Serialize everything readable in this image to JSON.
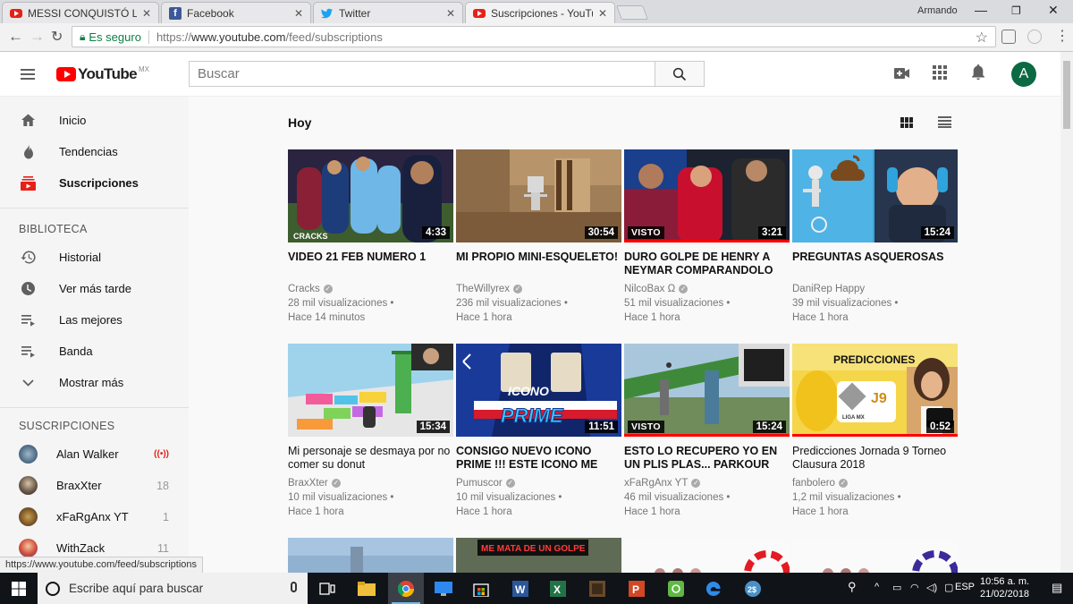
{
  "browser": {
    "tabs": [
      {
        "title": "MESSI CONQUISTÓ LON",
        "favicon": "youtube-favicon",
        "active": false
      },
      {
        "title": "Facebook",
        "favicon": "facebook-favicon",
        "active": false
      },
      {
        "title": "Twitter",
        "favicon": "twitter-favicon",
        "active": false
      },
      {
        "title": "Suscripciones - YouTube",
        "favicon": "youtube-favicon",
        "active": true
      }
    ],
    "profile_name": "Armando",
    "secure_label": "Es seguro",
    "url_scheme": "https://",
    "url_host": "www.youtube.com",
    "url_path": "/feed/subscriptions",
    "status_url": "https://www.youtube.com/feed/subscriptions"
  },
  "masthead": {
    "logo_text": "YouTube",
    "country_code": "MX",
    "search_placeholder": "Buscar",
    "avatar_letter": "A"
  },
  "sidebar": {
    "nav": [
      {
        "label": "Inicio",
        "icon": "home-icon"
      },
      {
        "label": "Tendencias",
        "icon": "flame-icon"
      },
      {
        "label": "Suscripciones",
        "icon": "subscriptions-icon",
        "active": true
      }
    ],
    "library_heading": "BIBLIOTECA",
    "library": [
      {
        "label": "Historial",
        "icon": "history-icon"
      },
      {
        "label": "Ver más tarde",
        "icon": "clock-icon"
      },
      {
        "label": "Las mejores",
        "icon": "playlist-icon"
      },
      {
        "label": "Banda",
        "icon": "playlist-icon"
      },
      {
        "label": "Mostrar más",
        "icon": "chevron-down-icon"
      }
    ],
    "subscriptions_heading": "SUSCRIPCIONES",
    "subscriptions": [
      {
        "name": "Alan Walker",
        "count": "((•))",
        "live": true
      },
      {
        "name": "BraxXter",
        "count": "18"
      },
      {
        "name": "xFaRgAnx YT",
        "count": "1"
      },
      {
        "name": "WithZack",
        "count": "11"
      }
    ]
  },
  "main": {
    "shelf_title": "Hoy",
    "videos": [
      {
        "title": "VIDEO 21 FEB NUMERO 1",
        "channel": "Cracks",
        "views": "28 mil visualizaciones",
        "age": "Hace 14 minutos",
        "duration": "4:33",
        "watched": "",
        "verified": true,
        "bold": true
      },
      {
        "title": "MI PROPIO MINI-ESQUELETO!",
        "channel": "TheWillyrex",
        "views": "236 mil visualizaciones",
        "age": "Hace 1 hora",
        "duration": "30:54",
        "watched": "",
        "verified": true,
        "bold": true
      },
      {
        "title": "DURO GOLPE DE HENRY A NEYMAR COMPARANDOLO",
        "channel": "NilcoBax Ω",
        "views": "51 mil visualizaciones",
        "age": "Hace 1 hora",
        "duration": "3:21",
        "watched": "VISTO",
        "progress": 1.0,
        "verified": true,
        "bold": true
      },
      {
        "title": "PREGUNTAS ASQUEROSAS",
        "channel": "DaniRep Happy",
        "views": "39 mil visualizaciones",
        "age": "Hace 1 hora",
        "duration": "15:24",
        "watched": "",
        "verified": false,
        "bold": true
      },
      {
        "title": "Mi personaje se desmaya por no comer su donut",
        "channel": "BraxXter",
        "views": "10 mil visualizaciones",
        "age": "Hace 1 hora",
        "duration": "15:34",
        "watched": "",
        "verified": true,
        "bold": false
      },
      {
        "title": "CONSIGO NUEVO ICONO PRIME !!! ESTE ICONO ME",
        "channel": "Pumuscor",
        "views": "10 mil visualizaciones",
        "age": "Hace 1 hora",
        "duration": "11:51",
        "watched": "",
        "verified": true,
        "bold": true
      },
      {
        "title": "ESTO LO RECUPERO YO EN UN PLIS PLAS... PARKOUR",
        "channel": "xFaRgAnx YT",
        "views": "46 mil visualizaciones",
        "age": "Hace 1 hora",
        "duration": "15:24",
        "watched": "VISTO",
        "progress": 1.0,
        "verified": true,
        "bold": true
      },
      {
        "title": "Predicciones Jornada 9 Torneo Clausura 2018",
        "channel": "fanbolero",
        "views": "1,2 mil visualizaciones",
        "age": "Hace 1 hora",
        "duration": "0:52",
        "watched": "",
        "progress": 1.0,
        "verified": true,
        "bold": false
      }
    ],
    "thumb_texts": {
      "cracks": "CRACKS",
      "icono": "ICONO",
      "prime": "PRIME",
      "predicciones": "PREDICCIONES",
      "j9": "J9",
      "liga": "LIGA MX",
      "golpe": "ME MATA DE UN GOLPE"
    }
  },
  "taskbar": {
    "search_placeholder": "Escribe aquí para buscar",
    "language": "ESP",
    "time": "10:56 a. m.",
    "date": "21/02/2018"
  },
  "colors": {
    "youtube_red": "#ff0000",
    "secure_green": "#0b8043",
    "avatar_green": "#0b6a43",
    "taskbar": "#101318"
  }
}
